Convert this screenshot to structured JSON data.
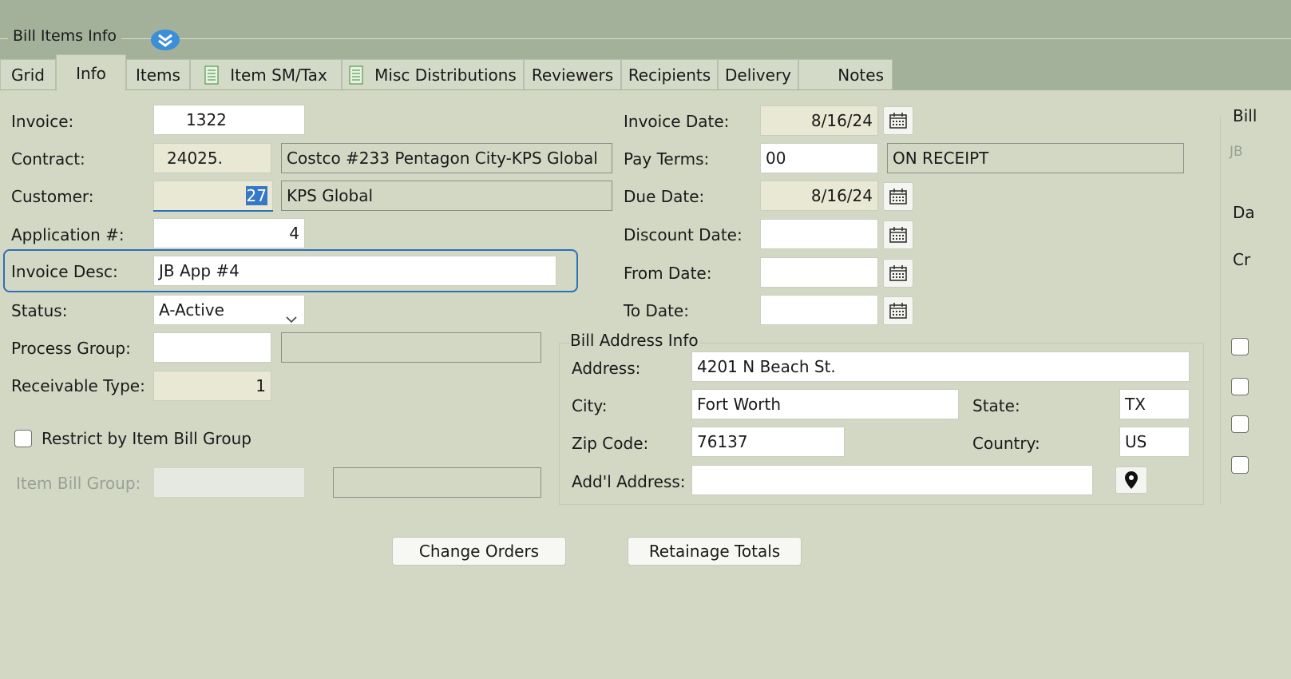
{
  "group_title": "Bill Items Info",
  "tabs": [
    {
      "label": "Grid"
    },
    {
      "label": "Info"
    },
    {
      "label": "Items"
    },
    {
      "label": "Item SM/Tax"
    },
    {
      "label": "Misc Distributions"
    },
    {
      "label": "Reviewers"
    },
    {
      "label": "Recipients"
    },
    {
      "label": "Delivery"
    },
    {
      "label": "Notes"
    }
  ],
  "left": {
    "invoice_label": "Invoice:",
    "invoice_value": "1322",
    "contract_label": "Contract:",
    "contract_value": "24025.",
    "contract_desc": "Costco #233 Pentagon City-KPS Global",
    "customer_label": "Customer:",
    "customer_value": "27",
    "customer_desc": "KPS Global",
    "application_label": "Application #:",
    "application_value": "4",
    "invoice_desc_label": "Invoice Desc:",
    "invoice_desc_value": "JB App #4",
    "status_label": "Status:",
    "status_value": "A-Active",
    "process_group_label": "Process Group:",
    "process_group_value": "",
    "process_group_desc": "",
    "receivable_type_label": "Receivable Type:",
    "receivable_type_value": "1",
    "restrict_label": "Restrict by Item Bill Group",
    "item_bill_group_label": "Item Bill Group:",
    "item_bill_group_value": "",
    "item_bill_group_desc": ""
  },
  "dates": {
    "invoice_date_label": "Invoice Date:",
    "invoice_date_value": "8/16/24",
    "pay_terms_label": "Pay Terms:",
    "pay_terms_value": "00",
    "pay_terms_desc": "ON RECEIPT",
    "due_date_label": "Due Date:",
    "due_date_value": "8/16/24",
    "discount_date_label": "Discount Date:",
    "discount_date_value": "",
    "from_date_label": "From Date:",
    "from_date_value": "",
    "to_date_label": "To Date:",
    "to_date_value": ""
  },
  "address": {
    "group_title": "Bill Address Info",
    "address_label": "Address:",
    "address_value": "4201 N Beach St.",
    "city_label": "City:",
    "city_value": "Fort Worth",
    "state_label": "State:",
    "state_value": "TX",
    "zip_label": "Zip Code:",
    "zip_value": "76137",
    "country_label": "Country:",
    "country_value": "US",
    "addl_label": "Add'l Address:",
    "addl_value": ""
  },
  "right_panel": {
    "title_partial": "Bill",
    "jb_partial": "JB",
    "da_partial": "Da",
    "cr_partial": "Cr"
  },
  "buttons": {
    "change_orders": "Change Orders",
    "retainage_totals": "Retainage Totals"
  },
  "colors": {
    "header_bg": "#a3b19a",
    "panel_bg": "#d2d8c4",
    "readonly_bg": "#e9e8d4",
    "focus_blue": "#2f6fb3"
  }
}
